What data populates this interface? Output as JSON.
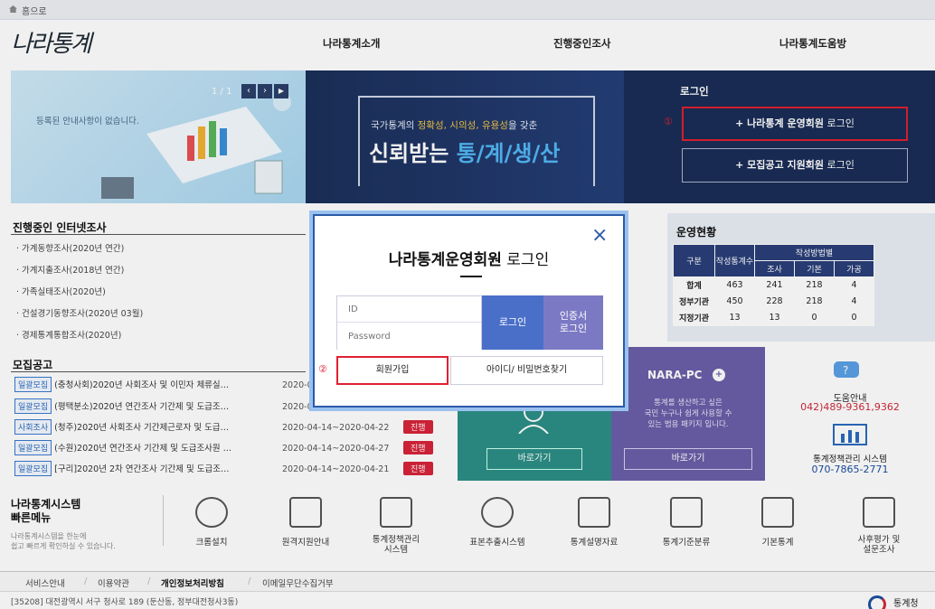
{
  "homebar": {
    "label": "홈으로"
  },
  "header": {
    "logo": "나라통계",
    "nav": [
      "나라통계소개",
      "진행중인조사",
      "나라통계도움방"
    ]
  },
  "banner_left": {
    "pager": "1 / 1",
    "notice": "등록된 안내사항이 없습니다."
  },
  "banner_mid": {
    "sub_pre": "국가통계의 ",
    "sub_hl": "정확성, 시의성, 유용성",
    "sub_post": "을 갖춘",
    "title_pre": "신뢰받는 ",
    "title_hl": "통/계/생/산"
  },
  "login_panel": {
    "title": "로그인",
    "marker1": "①",
    "btn1_bold": "+ 나라통계 운영회원",
    "btn1_rest": " 로그인",
    "btn2_bold": "+ 모집공고 지원회원",
    "btn2_rest": " 로그인"
  },
  "survey": {
    "title": "진행중인 인터넷조사",
    "items": [
      "가계동향조사(2020년 연간)",
      "가계지출조사(2018년 연간)",
      "가족실태조사(2020년)",
      "건설경기동향조사(2020년 03월)",
      "경제통계통합조사(2020년)"
    ]
  },
  "status": {
    "title": "운영현황",
    "headers": {
      "col1": "구분",
      "col2": "작성통계수",
      "group": "작성방법별",
      "sub": [
        "조사",
        "기본",
        "가공"
      ]
    },
    "rows": [
      {
        "label": "합계",
        "values": [
          "463",
          "241",
          "218",
          "4"
        ]
      },
      {
        "label": "정부기관",
        "values": [
          "450",
          "228",
          "218",
          "4"
        ]
      },
      {
        "label": "지정기관",
        "values": [
          "13",
          "13",
          "0",
          "0"
        ]
      }
    ]
  },
  "recruit": {
    "title": "모집공고",
    "items": [
      {
        "tag": "일괄모집",
        "text": "(충청사회)2020년 사회조사 및 이민자 체류실…",
        "date": "2020-0",
        "status": ""
      },
      {
        "tag": "일괄모집",
        "text": "(평택분소)2020년 연간조사 기간제 및 도급조…",
        "date": "2020-0",
        "status": ""
      },
      {
        "tag": "사회조사",
        "text": "(청주)2020년 사회조사 기간제근로자 및 도급…",
        "date": "2020-04-14~2020-04-22",
        "status": "진행"
      },
      {
        "tag": "일괄모집",
        "text": "(수원)2020년 연간조사 기간제 및 도급조사원 …",
        "date": "2020-04-14~2020-04-27",
        "status": "진행"
      },
      {
        "tag": "일괄모집",
        "text": "[구리]2020년 2차 연간조사 기간제 및 도급조…",
        "date": "2020-04-14~2020-04-21",
        "status": "진행"
      }
    ]
  },
  "cards": {
    "green_button": "바로가기",
    "narapc_title": "NARA-PC",
    "narapc_desc": [
      "통계를 생산하고 싶은",
      "국민 누구나 쉽게 사용할 수",
      "있는 범용 패키지 입니다."
    ],
    "narapc_button": "바로가기",
    "help_title": "도움안내",
    "help_phone": "042)489-9361,9362",
    "policy_title": "통계정책관리 시스템",
    "policy_phone": "070-7865-2771"
  },
  "modal": {
    "title_bold": "나라통계운영회원",
    "title_rest": " 로그인",
    "id_placeholder": "ID",
    "pw_placeholder": "Password",
    "login_button": "로그인",
    "cert_button_l1": "인증서",
    "cert_button_l2": "로그인",
    "marker2": "②",
    "join_button": "회원가입",
    "find_button": "아이디/ 비밀번호찾기"
  },
  "quickmenu": {
    "title_l1": "나라통계시스템",
    "title_l2": "빠른메뉴",
    "desc_l1": "나라통계시스템을 한눈에",
    "desc_l2": "쉽고 빠르게 확인하실 수 있습니다.",
    "items": [
      {
        "label": "크롬설치"
      },
      {
        "label": "원격지원안내"
      },
      {
        "label": "통계정책관리\n시스템"
      },
      {
        "label": "표본추출시스템"
      },
      {
        "label": "통계설명자료"
      },
      {
        "label": "통계기준분류"
      },
      {
        "label": "기본통계"
      },
      {
        "label": "사후평가 및\n설문조사"
      }
    ]
  },
  "footer": {
    "links": [
      "서비스안내",
      "이용약관",
      "개인정보처리방침",
      "이메일무단수집거부"
    ],
    "address": "[35208] 대전광역시 서구 청사로 189 (둔산동, 정부대전청사3동)",
    "brand": "통계청"
  },
  "colors": {
    "navy": "#1a2d57",
    "accent_red": "#e02030",
    "accent_blue": "#2b5aa8",
    "login_purple": "#7b79c4",
    "login_blue": "#4a6fc8"
  }
}
